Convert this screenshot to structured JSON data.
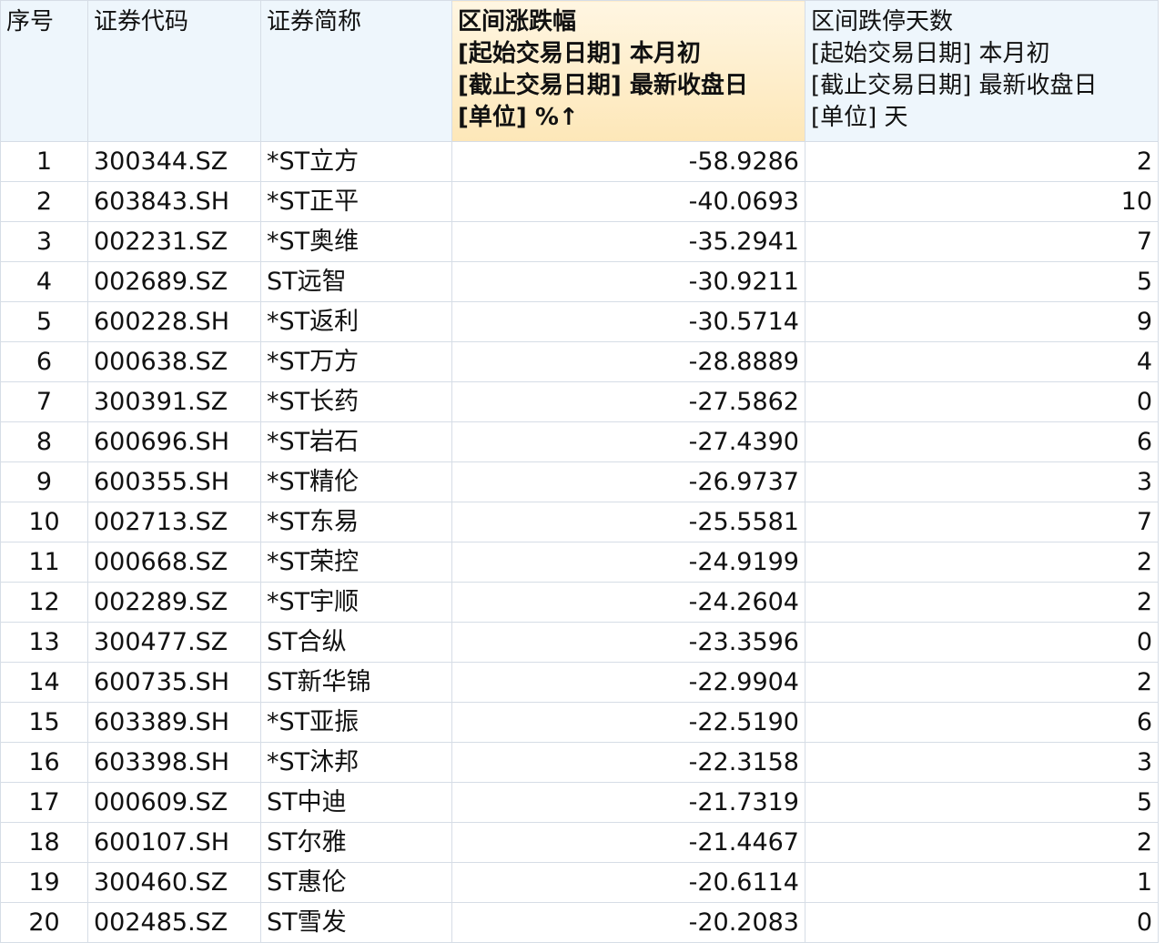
{
  "headers": [
    {
      "lines": [
        "序号"
      ]
    },
    {
      "lines": [
        "证券代码"
      ]
    },
    {
      "lines": [
        "证券简称"
      ]
    },
    {
      "lines": [
        "区间涨跌幅",
        "[起始交易日期] 本月初",
        "[截止交易日期] 最新收盘日",
        "[单位] %↑"
      ]
    },
    {
      "lines": [
        "区间跌停天数",
        "[起始交易日期] 本月初",
        "[截止交易日期] 最新收盘日",
        "[单位] 天"
      ]
    }
  ],
  "rows": [
    {
      "idx": "1",
      "code": "300344.SZ",
      "name": "*ST立方",
      "change": "-58.9286",
      "days": "2"
    },
    {
      "idx": "2",
      "code": "603843.SH",
      "name": "*ST正平",
      "change": "-40.0693",
      "days": "10"
    },
    {
      "idx": "3",
      "code": "002231.SZ",
      "name": "*ST奥维",
      "change": "-35.2941",
      "days": "7"
    },
    {
      "idx": "4",
      "code": "002689.SZ",
      "name": "ST远智",
      "change": "-30.9211",
      "days": "5"
    },
    {
      "idx": "5",
      "code": "600228.SH",
      "name": "*ST返利",
      "change": "-30.5714",
      "days": "9"
    },
    {
      "idx": "6",
      "code": "000638.SZ",
      "name": "*ST万方",
      "change": "-28.8889",
      "days": "4"
    },
    {
      "idx": "7",
      "code": "300391.SZ",
      "name": "*ST长药",
      "change": "-27.5862",
      "days": "0"
    },
    {
      "idx": "8",
      "code": "600696.SH",
      "name": "*ST岩石",
      "change": "-27.4390",
      "days": "6"
    },
    {
      "idx": "9",
      "code": "600355.SH",
      "name": "*ST精伦",
      "change": "-26.9737",
      "days": "3"
    },
    {
      "idx": "10",
      "code": "002713.SZ",
      "name": "*ST东易",
      "change": "-25.5581",
      "days": "7"
    },
    {
      "idx": "11",
      "code": "000668.SZ",
      "name": "*ST荣控",
      "change": "-24.9199",
      "days": "2"
    },
    {
      "idx": "12",
      "code": "002289.SZ",
      "name": "*ST宇顺",
      "change": "-24.2604",
      "days": "2"
    },
    {
      "idx": "13",
      "code": "300477.SZ",
      "name": "ST合纵",
      "change": "-23.3596",
      "days": "0"
    },
    {
      "idx": "14",
      "code": "600735.SH",
      "name": "ST新华锦",
      "change": "-22.9904",
      "days": "2"
    },
    {
      "idx": "15",
      "code": "603389.SH",
      "name": "*ST亚振",
      "change": "-22.5190",
      "days": "6"
    },
    {
      "idx": "16",
      "code": "603398.SH",
      "name": "*ST沐邦",
      "change": "-22.3158",
      "days": "3"
    },
    {
      "idx": "17",
      "code": "000609.SZ",
      "name": "ST中迪",
      "change": "-21.7319",
      "days": "5"
    },
    {
      "idx": "18",
      "code": "600107.SH",
      "name": "ST尔雅",
      "change": "-21.4467",
      "days": "2"
    },
    {
      "idx": "19",
      "code": "300460.SZ",
      "name": "ST惠伦",
      "change": "-20.6114",
      "days": "1"
    },
    {
      "idx": "20",
      "code": "002485.SZ",
      "name": "ST雪发",
      "change": "-20.2083",
      "days": "0"
    }
  ]
}
